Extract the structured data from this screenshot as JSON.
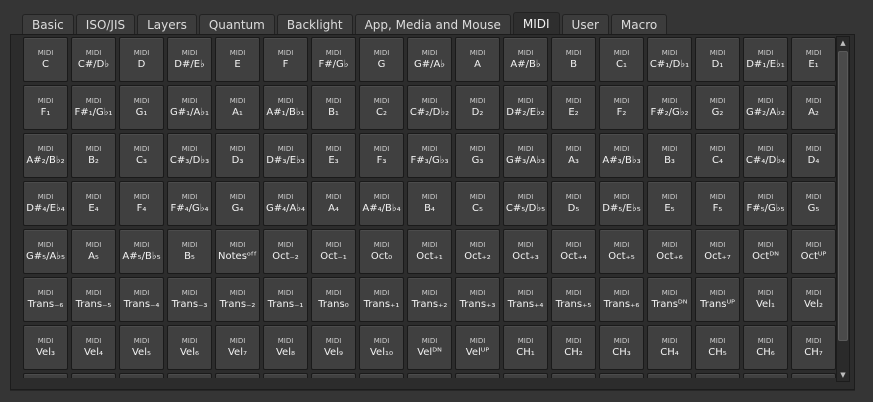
{
  "tabs": [
    {
      "label": "Basic",
      "active": false
    },
    {
      "label": "ISO/JIS",
      "active": false
    },
    {
      "label": "Layers",
      "active": false
    },
    {
      "label": "Quantum",
      "active": false
    },
    {
      "label": "Backlight",
      "active": false
    },
    {
      "label": "App, Media and Mouse",
      "active": false
    },
    {
      "label": "MIDI",
      "active": true
    },
    {
      "label": "User",
      "active": false
    },
    {
      "label": "Macro",
      "active": false
    }
  ],
  "key_title": "MIDI",
  "keys": [
    "C",
    "C#/D♭",
    "D",
    "D#/E♭",
    "E",
    "F",
    "F#/G♭",
    "G",
    "G#/A♭",
    "A",
    "A#/B♭",
    "B",
    "C₁",
    "C#₁/D♭₁",
    "D₁",
    "D#₁/E♭₁",
    "E₁",
    "F₁",
    "F#₁/G♭₁",
    "G₁",
    "G#₁/A♭₁",
    "A₁",
    "A#₁/B♭₁",
    "B₁",
    "C₂",
    "C#₂/D♭₂",
    "D₂",
    "D#₂/E♭₂",
    "E₂",
    "F₂",
    "F#₂/G♭₂",
    "G₂",
    "G#₂/A♭₂",
    "A₂",
    "A#₂/B♭₂",
    "B₂",
    "C₃",
    "C#₃/D♭₃",
    "D₃",
    "D#₃/E♭₃",
    "E₃",
    "F₃",
    "F#₃/G♭₃",
    "G₃",
    "G#₃/A♭₃",
    "A₃",
    "A#₃/B♭₃",
    "B₃",
    "C₄",
    "C#₄/D♭₄",
    "D₄",
    "D#₄/E♭₄",
    "E₄",
    "F₄",
    "F#₄/G♭₄",
    "G₄",
    "G#₄/A♭₄",
    "A₄",
    "A#₄/B♭₄",
    "B₄",
    "C₅",
    "C#₅/D♭₅",
    "D₅",
    "D#₅/E♭₅",
    "E₅",
    "F₅",
    "F#₅/G♭₅",
    "G₅",
    "G#₅/A♭₅",
    "A₅",
    "A#₅/B♭₅",
    "B₅",
    "Notesᵒᶠᶠ",
    "Oct₋₂",
    "Oct₋₁",
    "Oct₀",
    "Oct₊₁",
    "Oct₊₂",
    "Oct₊₃",
    "Oct₊₄",
    "Oct₊₅",
    "Oct₊₆",
    "Oct₊₇",
    "Octᴰᴺ",
    "Octᵁᴾ",
    "Trans₋₆",
    "Trans₋₅",
    "Trans₋₄",
    "Trans₋₃",
    "Trans₋₂",
    "Trans₋₁",
    "Trans₀",
    "Trans₊₁",
    "Trans₊₂",
    "Trans₊₃",
    "Trans₊₄",
    "Trans₊₅",
    "Trans₊₆",
    "Transᴰᴺ",
    "Transᵁᴾ",
    "Vel₁",
    "Vel₂",
    "Vel₃",
    "Vel₄",
    "Vel₅",
    "Vel₆",
    "Vel₇",
    "Vel₈",
    "Vel₉",
    "Vel₁₀",
    "Velᴰᴺ",
    "Velᵁᴾ",
    "CH₁",
    "CH₂",
    "CH₃",
    "CH₄",
    "CH₅",
    "CH₆",
    "CH₇",
    "",
    "",
    "",
    "",
    "",
    "",
    "",
    "",
    "",
    "",
    "",
    "",
    "",
    "",
    "",
    "",
    ""
  ],
  "scrollbar": {
    "up_icon": "▲",
    "down_icon": "▼"
  }
}
